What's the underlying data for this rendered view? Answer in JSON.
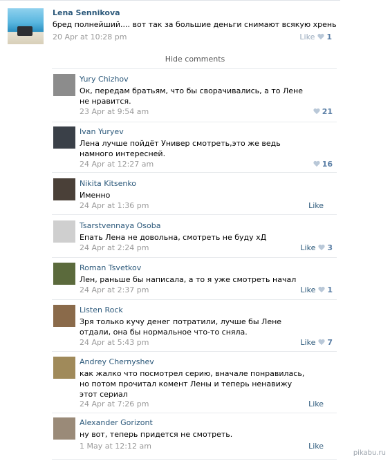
{
  "post": {
    "author": "Lena Sennikova",
    "text": "бред полнейший.... вот так за большие деньги снимают всякую хрень",
    "date": "20 Apr at 10:28 pm",
    "like_label": "Like",
    "like_count": "1"
  },
  "hide_comments_label": "Hide comments",
  "comments": [
    {
      "author": "Yury Chizhov",
      "text": "Ок, передам братьям, что бы сворачивались, а то Лене не нравится.",
      "date": "23 Apr at 9:54 am",
      "like_label": "",
      "like_count": "21",
      "avatar_color": "#8c8c8c"
    },
    {
      "author": "Ivan Yuryev",
      "text": "Лена лучше пойдёт Универ смотреть,это же ведь намного интересней.",
      "date": "24 Apr at 12:27 am",
      "like_label": "",
      "like_count": "16",
      "avatar_color": "#3a4048"
    },
    {
      "author": "Nikita Kitsenko",
      "text": "Именно",
      "date": "24 Apr at 1:36 pm",
      "like_label": "Like",
      "like_count": "",
      "avatar_color": "#4a4038"
    },
    {
      "author": "Tsarstvennaya Osoba",
      "text": "Епать Лена не довольна, смотреть не буду хД",
      "date": "24 Apr at 2:24 pm",
      "like_label": "Like",
      "like_count": "3",
      "avatar_color": "#cfcfcf"
    },
    {
      "author": "Roman Tsvetkov",
      "text": "Лен, раньше бы написала, а то я уже смотреть начал",
      "date": "24 Apr at 2:37 pm",
      "like_label": "Like",
      "like_count": "1",
      "avatar_color": "#5b6a3c"
    },
    {
      "author": "Listen Rock",
      "text": "Зря только кучу денег потратили, лучше бы Лене отдали, она бы нормальное что-то сняла.",
      "date": "24 Apr at 5:43 pm",
      "like_label": "Like",
      "like_count": "7",
      "avatar_color": "#8a6a4a"
    },
    {
      "author": "Andrey Chernyshev",
      "text": "как жалко что посмотрел серию, вначале понравилась, но потом прочитал комент Лены и теперь ненавижу этот сериал",
      "date": "24 Apr at 7:26 pm",
      "like_label": "Like",
      "like_count": "",
      "avatar_color": "#a08a5a"
    },
    {
      "author": "Alexander Gorizont",
      "text": "ну вот, теперь придется не смотреть.",
      "date": "1 May at 12:12 am",
      "like_label": "Like",
      "like_count": "",
      "avatar_color": "#9a8a78"
    }
  ],
  "watermark": "pikabu.ru"
}
